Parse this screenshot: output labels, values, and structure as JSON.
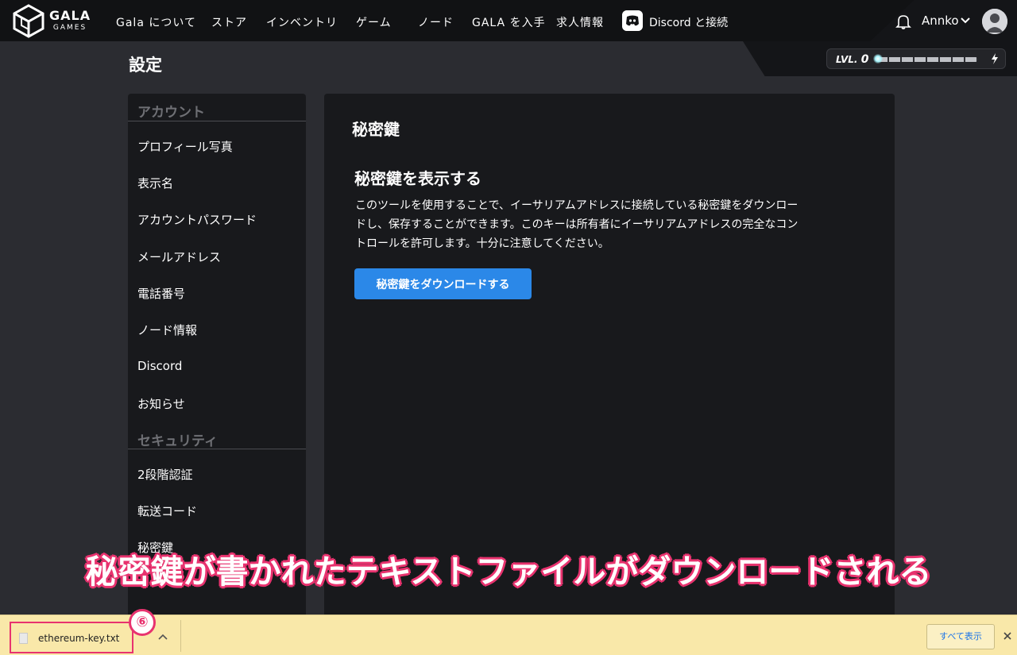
{
  "brand": {
    "name": "GALA",
    "sub": "GAMES"
  },
  "nav": {
    "items": [
      {
        "label": "Gala について"
      },
      {
        "label": "ストア"
      },
      {
        "label": "インベントリ"
      },
      {
        "label": "ゲーム"
      },
      {
        "label": "ノード"
      },
      {
        "label": "GALA を入手"
      },
      {
        "label": "求人情報"
      }
    ],
    "discord_label": "Discord と接続",
    "user_name": "Annko"
  },
  "level": {
    "prefix": "LVL.",
    "value": "0",
    "progress": 0
  },
  "page": {
    "title": "設定"
  },
  "sidebar": {
    "sections": [
      {
        "heading": "アカウント",
        "items": [
          "プロフィール写真",
          "表示名",
          "アカウントパスワード",
          "メールアドレス",
          "電話番号",
          "ノード情報",
          "Discord",
          "お知らせ"
        ]
      },
      {
        "heading": "セキュリティ",
        "items": [
          "2段階認証",
          "転送コード",
          "秘密鍵"
        ]
      }
    ]
  },
  "panel": {
    "title": "秘密鍵",
    "subtitle": "秘密鍵を表示する",
    "description": "このツールを使用することで、イーサリアムアドレスに接続している秘密鍵をダウンロードし、保存することができます。このキーは所有者にイーサリアムアドレスの完全なコントロールを許可します。十分に注意してください。",
    "button_label": "秘密鍵をダウンロードする"
  },
  "caption": "秘密鍵が書かれたテキストファイルがダウンロードされる",
  "download_bar": {
    "file_name": "ethereum-key.txt",
    "step_badge": "⑥",
    "show_all_label": "すべて表示"
  },
  "colors": {
    "accent": "#2b88e8",
    "highlight": "#e8336f",
    "download_bar": "#f9e8a9"
  }
}
